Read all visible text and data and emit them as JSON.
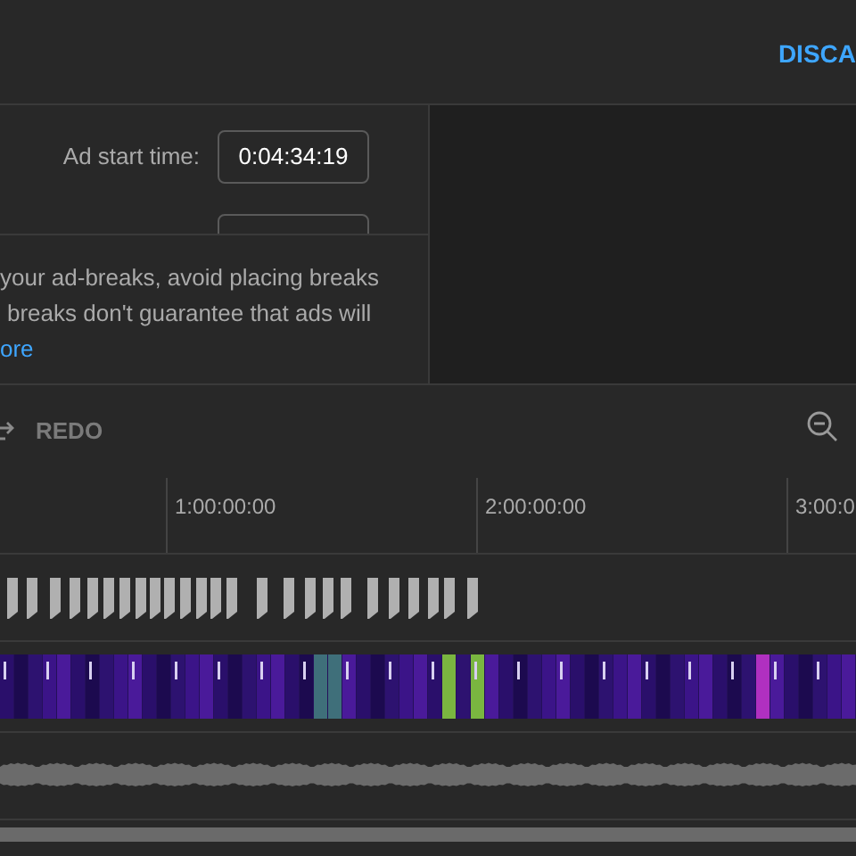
{
  "header": {
    "discard_button": "DISCA"
  },
  "ad_form": {
    "start_time_label": "Ad start time:",
    "start_time_value": "0:04:34:19"
  },
  "info": {
    "lines": [
      "your ad-breaks, avoid placing breaks",
      "breaks don't guarantee that ads will"
    ],
    "link": "ore"
  },
  "toolbar": {
    "redo_label": "REDO"
  },
  "ruler": {
    "ticks": [
      "1:00:00:00",
      "2:00:00:00",
      "3:00:0"
    ]
  }
}
